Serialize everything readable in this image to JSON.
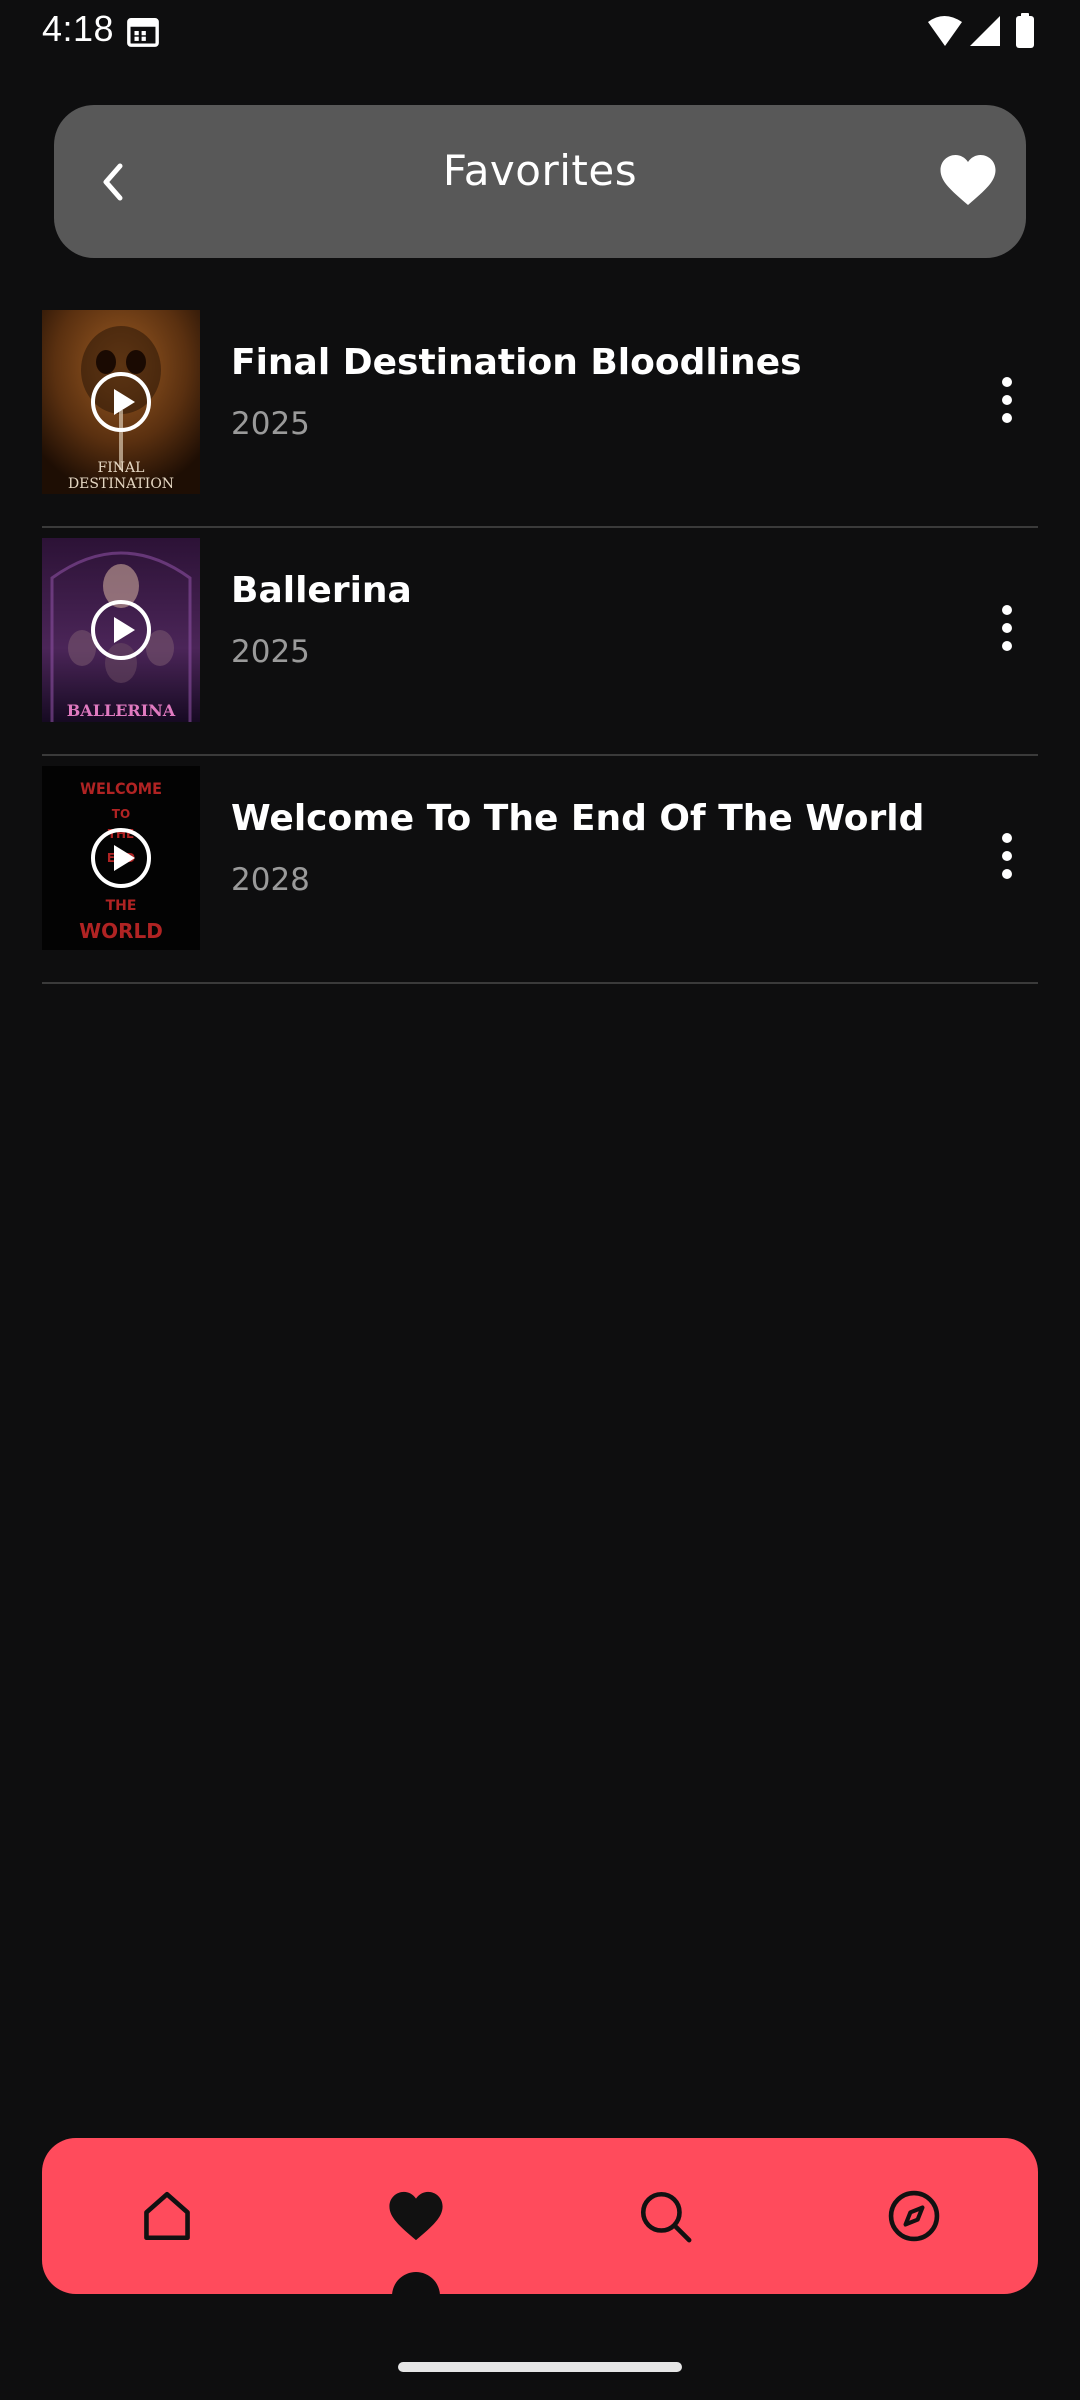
{
  "status_bar": {
    "time": "4:18",
    "icons": [
      "calendar-icon",
      "wifi-icon",
      "signal-icon",
      "battery-icon"
    ]
  },
  "header": {
    "title": "Favorites",
    "back_icon": "chevron-left-icon",
    "action_icon": "heart-icon"
  },
  "favorites": [
    {
      "title": "Final Destination Bloodlines",
      "year": "2025",
      "poster_text": [
        "FINAL",
        "DESTINATION"
      ],
      "poster_colors": [
        "#6a3a16",
        "#2a1608"
      ]
    },
    {
      "title": "Ballerina",
      "year": "2025",
      "poster_text": [
        "BALLERINA"
      ],
      "poster_colors": [
        "#3b1f4a",
        "#150a22"
      ]
    },
    {
      "title": "Welcome To The End Of The World",
      "year": "2028",
      "poster_text": [
        "WELCOME",
        "TO",
        "THE",
        "END",
        "THE",
        "WORLD"
      ],
      "poster_colors": [
        "#000000",
        "#050505"
      ]
    }
  ],
  "bottom_nav": {
    "items": [
      {
        "name": "home",
        "icon": "home-icon",
        "active": false
      },
      {
        "name": "favorites",
        "icon": "heart-icon",
        "active": true
      },
      {
        "name": "search",
        "icon": "search-icon",
        "active": false
      },
      {
        "name": "explore",
        "icon": "compass-icon",
        "active": false
      }
    ],
    "accent": "#ff4b5c"
  },
  "colors": {
    "background": "#0e0e0f",
    "header_bg": "#585858",
    "year_text": "#9a9a9a",
    "divider": "#3a3a3a"
  }
}
